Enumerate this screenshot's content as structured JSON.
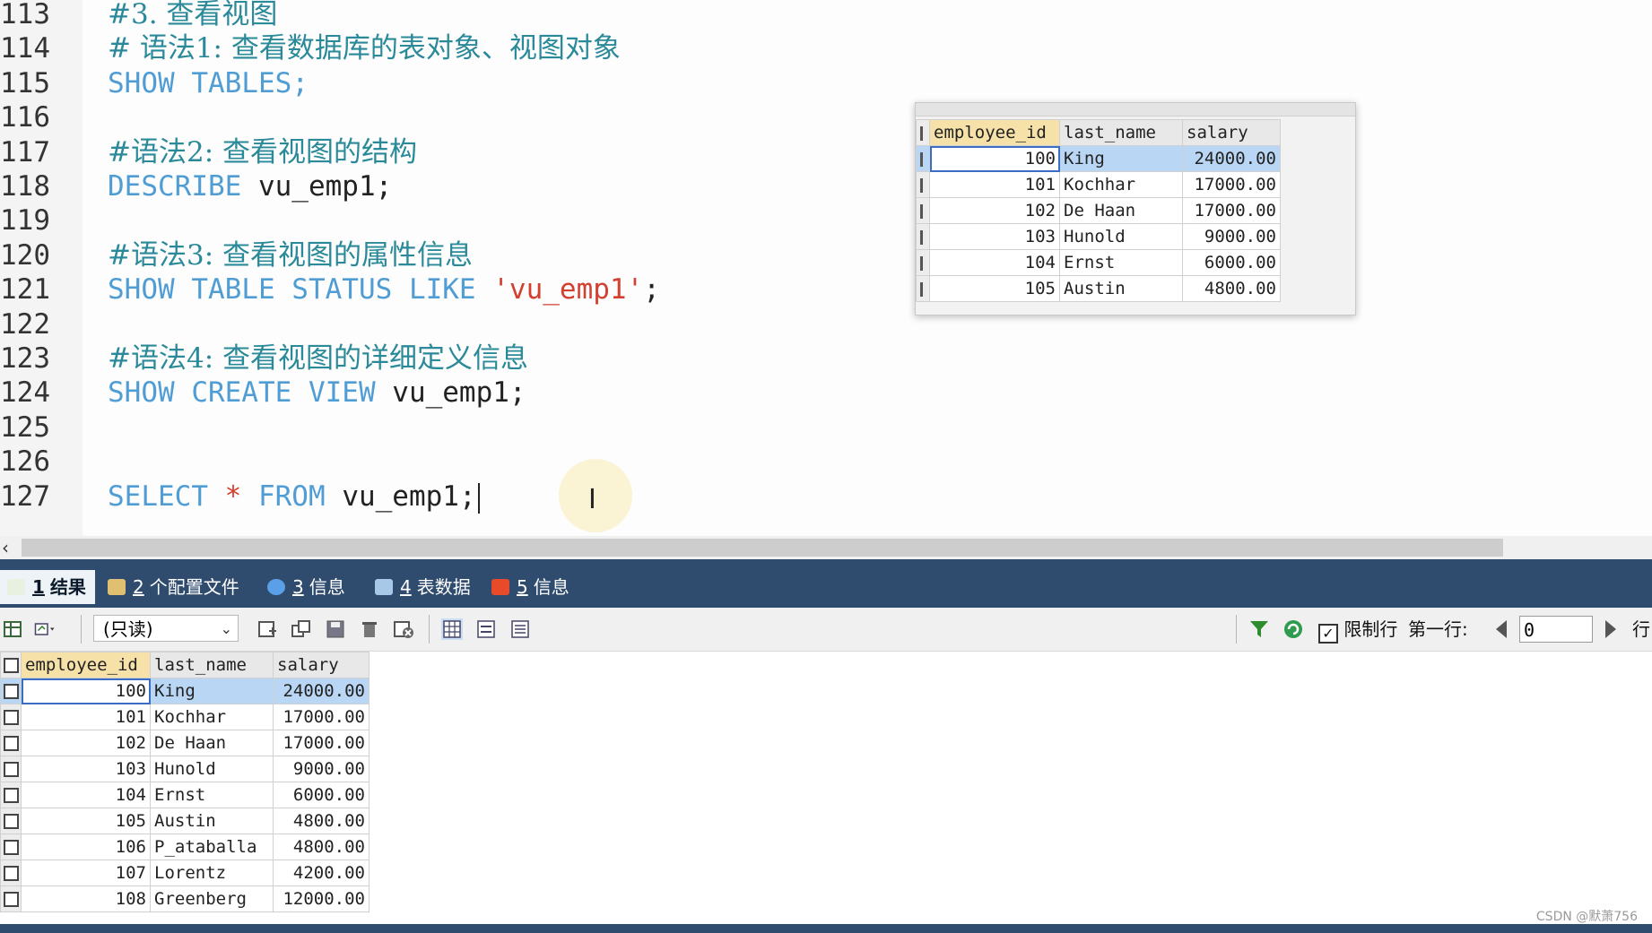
{
  "editor": {
    "lines": [
      {
        "num": "113",
        "tokens": [
          {
            "t": "#3. 查看视图",
            "c": "cmt"
          }
        ]
      },
      {
        "num": "114",
        "tokens": [
          {
            "t": "# 语法1: 查看数据库的表对象、视图对象",
            "c": "cmt"
          }
        ]
      },
      {
        "num": "115",
        "tokens": [
          {
            "t": "SHOW TABLES",
            "c": "kw"
          },
          {
            "t": ";",
            "c": "kw"
          }
        ]
      },
      {
        "num": "116",
        "tokens": []
      },
      {
        "num": "117",
        "tokens": [
          {
            "t": "#语法2: 查看视图的结构",
            "c": "cmt"
          }
        ]
      },
      {
        "num": "118",
        "tokens": [
          {
            "t": "DESCRIBE ",
            "c": "kw"
          },
          {
            "t": "vu_emp1;",
            "c": "id"
          }
        ]
      },
      {
        "num": "119",
        "tokens": []
      },
      {
        "num": "120",
        "tokens": [
          {
            "t": "#语法3: 查看视图的属性信息",
            "c": "cmt"
          }
        ]
      },
      {
        "num": "121",
        "tokens": [
          {
            "t": "SHOW TABLE STATUS LIKE ",
            "c": "kw"
          },
          {
            "t": "'vu_emp1'",
            "c": "str"
          },
          {
            "t": ";",
            "c": "id"
          }
        ]
      },
      {
        "num": "122",
        "tokens": []
      },
      {
        "num": "123",
        "tokens": [
          {
            "t": "#语法4: 查看视图的详细定义信息",
            "c": "cmt"
          }
        ]
      },
      {
        "num": "124",
        "tokens": [
          {
            "t": "SHOW CREATE VIEW ",
            "c": "kw"
          },
          {
            "t": "vu_emp1;",
            "c": "id"
          }
        ]
      },
      {
        "num": "125",
        "tokens": []
      },
      {
        "num": "126",
        "tokens": []
      },
      {
        "num": "127",
        "tokens": [
          {
            "t": "SELECT ",
            "c": "kw"
          },
          {
            "t": "* ",
            "c": "str"
          },
          {
            "t": "FROM ",
            "c": "kw"
          },
          {
            "t": "vu_emp1;",
            "c": "id"
          }
        ]
      }
    ]
  },
  "popup": {
    "columns": [
      "employee_id",
      "last_name",
      "salary"
    ],
    "rows": [
      [
        "100",
        "King",
        "24000.00"
      ],
      [
        "101",
        "Kochhar",
        "17000.00"
      ],
      [
        "102",
        "De Haan",
        "17000.00"
      ],
      [
        "103",
        "Hunold",
        "9000.00"
      ],
      [
        "104",
        "Ernst",
        "6000.00"
      ],
      [
        "105",
        "Austin",
        "4800.00"
      ]
    ]
  },
  "tabs": [
    {
      "num": "1",
      "label": "结果",
      "icon": "result-icon",
      "active": true
    },
    {
      "num": "2",
      "label": "个配置文件",
      "icon": "profile-icon",
      "active": false
    },
    {
      "num": "3",
      "label": "信息",
      "icon": "info-icon",
      "active": false
    },
    {
      "num": "4",
      "label": "表数据",
      "icon": "table-data-icon",
      "active": false
    },
    {
      "num": "5",
      "label": "信息",
      "icon": "info2-icon",
      "active": false
    }
  ],
  "toolbar": {
    "mode_select": "(只读)",
    "limit_rows_label": "限制行",
    "limit_rows_checked": true,
    "first_row_label": "第一行:",
    "first_row_value": "0",
    "rows_label": "行"
  },
  "results": {
    "columns": [
      "employee_id",
      "last_name",
      "salary"
    ],
    "rows": [
      [
        "100",
        "King",
        "24000.00"
      ],
      [
        "101",
        "Kochhar",
        "17000.00"
      ],
      [
        "102",
        "De Haan",
        "17000.00"
      ],
      [
        "103",
        "Hunold",
        "9000.00"
      ],
      [
        "104",
        "Ernst",
        "6000.00"
      ],
      [
        "105",
        "Austin",
        "4800.00"
      ],
      [
        "106",
        "P_ataballa",
        "4800.00"
      ],
      [
        "107",
        "Lorentz",
        "4200.00"
      ],
      [
        "108",
        "Greenberg",
        "12000.00"
      ]
    ]
  },
  "watermark": "CSDN @默萧756",
  "colors": {
    "tab_bar": "#2f4c6e",
    "keyword": "#4f9dd4",
    "comment": "#2b8a99",
    "string": "#d2402f",
    "selection": "#b9d7f4"
  }
}
